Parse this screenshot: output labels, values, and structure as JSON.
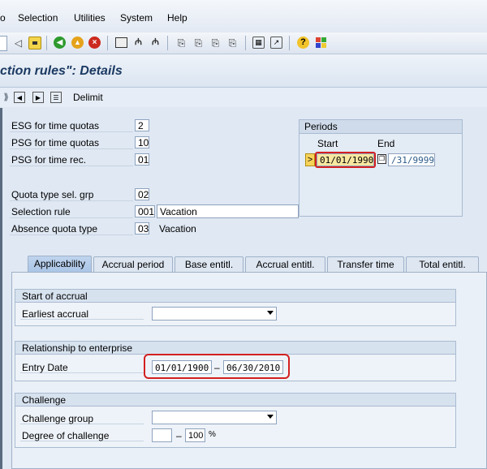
{
  "menu": {
    "item0": "o",
    "selection": "Selection",
    "utilities": "Utilities",
    "system": "System",
    "help": "Help"
  },
  "title": "ction rules\": Details",
  "app_toolbar": {
    "delimit": "Delimit"
  },
  "fields": {
    "esg_quotas": {
      "label": "ESG for time quotas",
      "value": "2"
    },
    "psg_quotas": {
      "label": "PSG for time quotas",
      "value": "10"
    },
    "psg_rec": {
      "label": "PSG for time rec.",
      "value": "01"
    },
    "quota_grp": {
      "label": "Quota type sel. grp",
      "value": "02"
    },
    "sel_rule": {
      "label": "Selection rule",
      "value": "001",
      "text": "Vacation"
    },
    "absence_quota": {
      "label": "Absence quota type",
      "value": "03",
      "text": "Vacation"
    }
  },
  "periods": {
    "title": "Periods",
    "start_label": "Start",
    "end_label": "End",
    "start_value": "01/01/1990",
    "end_value": "/31/9999",
    "marker": ">"
  },
  "tabs": [
    {
      "label": "Applicability",
      "active": true
    },
    {
      "label": "Accrual period"
    },
    {
      "label": "Base entitl."
    },
    {
      "label": "Accrual entitl."
    },
    {
      "label": "Transfer time"
    },
    {
      "label": "Total entitl."
    }
  ],
  "start_accrual": {
    "title": "Start of accrual",
    "earliest_label": "Earliest accrual",
    "earliest_value": ""
  },
  "relationship": {
    "title": "Relationship to enterprise",
    "entry_label": "Entry Date",
    "from": "01/01/1900",
    "dash": "–",
    "to": "06/30/2010"
  },
  "challenge": {
    "title": "Challenge",
    "group_label": "Challenge group",
    "group_value": "",
    "degree_label": "Degree of challenge",
    "degree_from": "",
    "dash": "–",
    "degree_to": "100",
    "unit": "%"
  }
}
